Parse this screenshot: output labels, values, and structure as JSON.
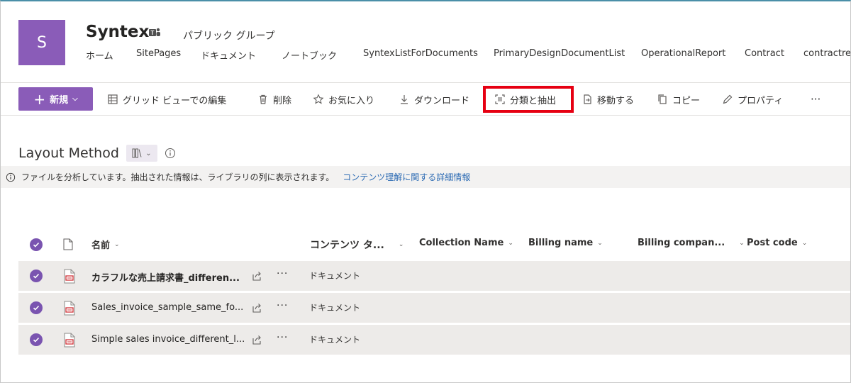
{
  "site": {
    "logo_letter": "S",
    "title": "Syntex",
    "group_type": "パブリック グループ",
    "nav": [
      "ホーム",
      "SitePages",
      "ドキュメント",
      "ノートブック",
      "SyntexListForDocuments",
      "PrimaryDesignDocumentList",
      "OperationalReport",
      "Contract",
      "contractrec"
    ]
  },
  "commandbar": {
    "new_label": "新規",
    "items": [
      "グリッド ビューでの編集",
      "削除",
      "お気に入り",
      "ダウンロード",
      "分類と抽出",
      "移動する",
      "コピー",
      "プロパティ"
    ],
    "more": "···"
  },
  "library": {
    "title": "Layout Method",
    "info_text": "ファイルを分析しています。抽出された情報は、ライブラリの列に表示されます。",
    "info_link": "コンテンツ理解に関する詳細情報"
  },
  "table": {
    "columns": [
      "名前",
      "コンテンツ タ...",
      "Collection Name",
      "Billing name",
      "Billing compan...",
      "Post code"
    ],
    "rows": [
      {
        "name": "カラフルな売上請求書_differen...",
        "content_type": "ドキュメント"
      },
      {
        "name": "Sales_invoice_sample_same_fo...",
        "content_type": "ドキュメント"
      },
      {
        "name": "Simple sales invoice_different_l...",
        "content_type": "ドキュメント"
      }
    ],
    "row_more": "···"
  },
  "colors": {
    "brand": "#8a5cb8",
    "highlight": "#e60012",
    "link": "#2b6ab3"
  }
}
